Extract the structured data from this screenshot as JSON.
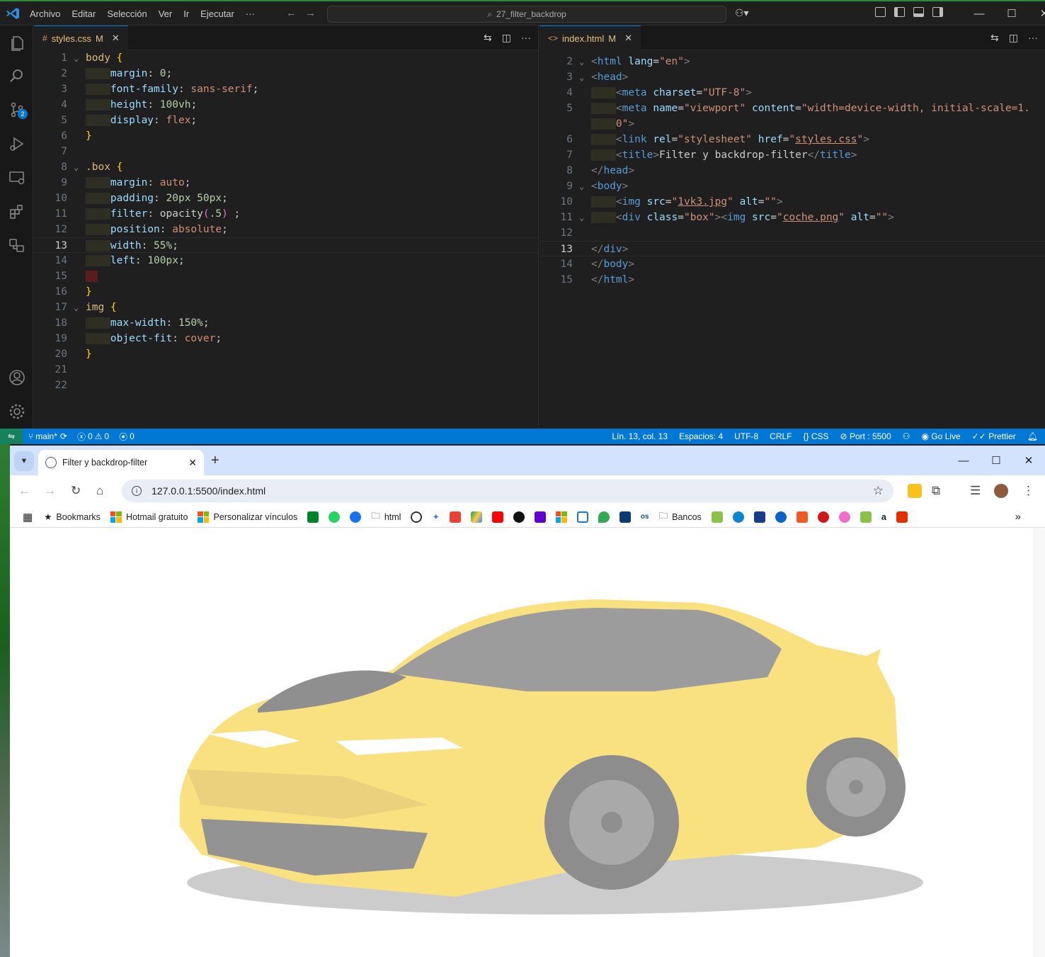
{
  "vscode": {
    "menu": [
      "Archivo",
      "Editar",
      "Selección",
      "Ver",
      "Ir",
      "Ejecutar",
      "···"
    ],
    "search": "27_filter_backdrop",
    "scm_badge": "2",
    "left_tab": {
      "name": "styles.css",
      "status": "M"
    },
    "right_tab": {
      "name": "index.html",
      "status": "M"
    },
    "status": {
      "branch": "main*",
      "errors": "0",
      "warnings": "0",
      "ports": "0",
      "position": "Lín. 13, col. 13",
      "spaces": "Espacios: 4",
      "encoding": "UTF-8",
      "eol": "CRLF",
      "language": "CSS",
      "port": "Port : 5500",
      "golive": "Go Live",
      "prettier": "Prettier"
    },
    "css_lines": [
      "1",
      "2",
      "3",
      "4",
      "5",
      "6",
      "7",
      "8",
      "9",
      "10",
      "11",
      "12",
      "13",
      "14",
      "15",
      "16",
      "17",
      "18",
      "19",
      "20",
      "21",
      "22"
    ],
    "html_lines": [
      "2",
      "3",
      "4",
      "5",
      "",
      "6",
      "7",
      "8",
      "9",
      "10",
      "11",
      "12",
      "13",
      "14",
      "15"
    ]
  },
  "chrome": {
    "tab_title": "Filter y backdrop-filter",
    "url": "127.0.0.1:5500/index.html",
    "bookmarks": {
      "bookmarks": "Bookmarks",
      "hotmail": "Hotmail gratuito",
      "personalizar": "Personalizar vínculos",
      "html": "html",
      "bancos": "Bancos"
    }
  },
  "colors": {
    "statusbar": "#0078d4",
    "accent": "#0078d4",
    "car_yellow": "#f2c500"
  }
}
